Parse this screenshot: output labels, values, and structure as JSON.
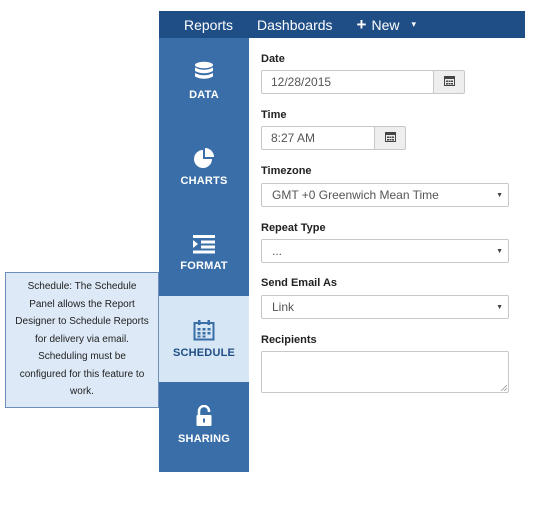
{
  "topnav": {
    "reports": "Reports",
    "dashboards": "Dashboards",
    "new_plus": "+",
    "new_label": "New",
    "new_caret": "▾"
  },
  "sidebar": {
    "items": [
      {
        "label": "DATA",
        "icon": "database-icon"
      },
      {
        "label": "CHARTS",
        "icon": "pie-chart-icon"
      },
      {
        "label": "FORMAT",
        "icon": "format-list-icon"
      },
      {
        "label": "SCHEDULE",
        "icon": "calendar-icon",
        "active": true
      },
      {
        "label": "SHARING",
        "icon": "unlock-icon"
      }
    ]
  },
  "form": {
    "date_label": "Date",
    "date_value": "12/28/2015",
    "time_label": "Time",
    "time_value": "8:27 AM",
    "timezone_label": "Timezone",
    "timezone_value": "GMT +0 Greenwich Mean Time",
    "repeat_label": "Repeat Type",
    "repeat_value": "...",
    "send_email_label": "Send Email As",
    "send_email_value": "Link",
    "recipients_label": "Recipients",
    "recipients_value": ""
  },
  "tooltip": {
    "text": "Schedule: The Schedule Panel allows the Report Designer to Schedule Reports for delivery via email. Scheduling must be configured for this feature to work."
  },
  "colors": {
    "topnav_bg": "#1f4e87",
    "sidebar_bg": "#3a6ea8",
    "sidebar_active_bg": "#d7e6f4",
    "tooltip_bg": "#dde9f6"
  }
}
